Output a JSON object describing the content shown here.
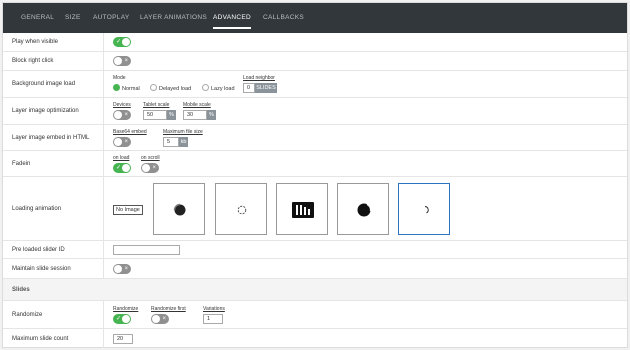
{
  "tabs": [
    {
      "label": "General"
    },
    {
      "label": "Size"
    },
    {
      "label": "Autoplay"
    },
    {
      "label": "Layer animations"
    },
    {
      "label": "Advanced"
    },
    {
      "label": "Callbacks"
    }
  ],
  "active_tab": "Advanced",
  "accent_color": "#46b450",
  "selected_color": "#2a74c1",
  "rows": {
    "play_when_visible": {
      "label": "Play when visible",
      "value": "on"
    },
    "block_right_click": {
      "label": "Block right click",
      "value": "off"
    },
    "background_image_load": {
      "label": "Background image load",
      "mode_label": "Mode",
      "options": [
        "Normal",
        "Delayed load",
        "Lazy load"
      ],
      "selected": "Normal",
      "load_neighbor_label": "Load neighbor",
      "load_neighbor_value": "0",
      "load_neighbor_unit": "SLIDES"
    },
    "layer_image_optimization": {
      "label": "Layer image optimization",
      "devices_label": "Devices",
      "devices_value": "off",
      "tablet_scale_label": "Tablet scale",
      "tablet_scale_value": "50",
      "mobile_scale_label": "Mobile scale",
      "mobile_scale_value": "30",
      "unit": "%"
    },
    "layer_image_embed": {
      "label": "Layer image embed in HTML",
      "base64_label": "Base64 embed",
      "base64_value": "off",
      "max_file_size_label": "Maximum file size",
      "max_file_size_value": "5",
      "max_file_size_unit": "kb"
    },
    "fadein": {
      "label": "Fadein",
      "on_load_label": "on load",
      "on_load_value": "on",
      "on_scroll_label": "on scroll",
      "on_scroll_value": "off"
    },
    "loading_animation": {
      "label": "Loading animation",
      "no_image_label": "No Image",
      "options": [
        "spinner-dot-icon",
        "spinner-ring-icon",
        "spinner-bars-icon",
        "spinner-crescent-icon",
        "spinner-arc-icon"
      ],
      "selected_index": 4
    },
    "pre_loaded_slider": {
      "label": "Pre loaded slider ID",
      "value": ""
    },
    "maintain_session": {
      "label": "Maintain slide session",
      "value": "off"
    },
    "slides_section": {
      "label": "Slides"
    },
    "randomize": {
      "label": "Randomize",
      "randomize_label": "Randomize",
      "randomize_value": "on",
      "randomize_first_label": "Randomize first",
      "randomize_first_value": "off",
      "variations_label": "Variations",
      "variations_value": "1"
    },
    "max_slide_count": {
      "label": "Maximum slide count",
      "value": "20"
    }
  }
}
